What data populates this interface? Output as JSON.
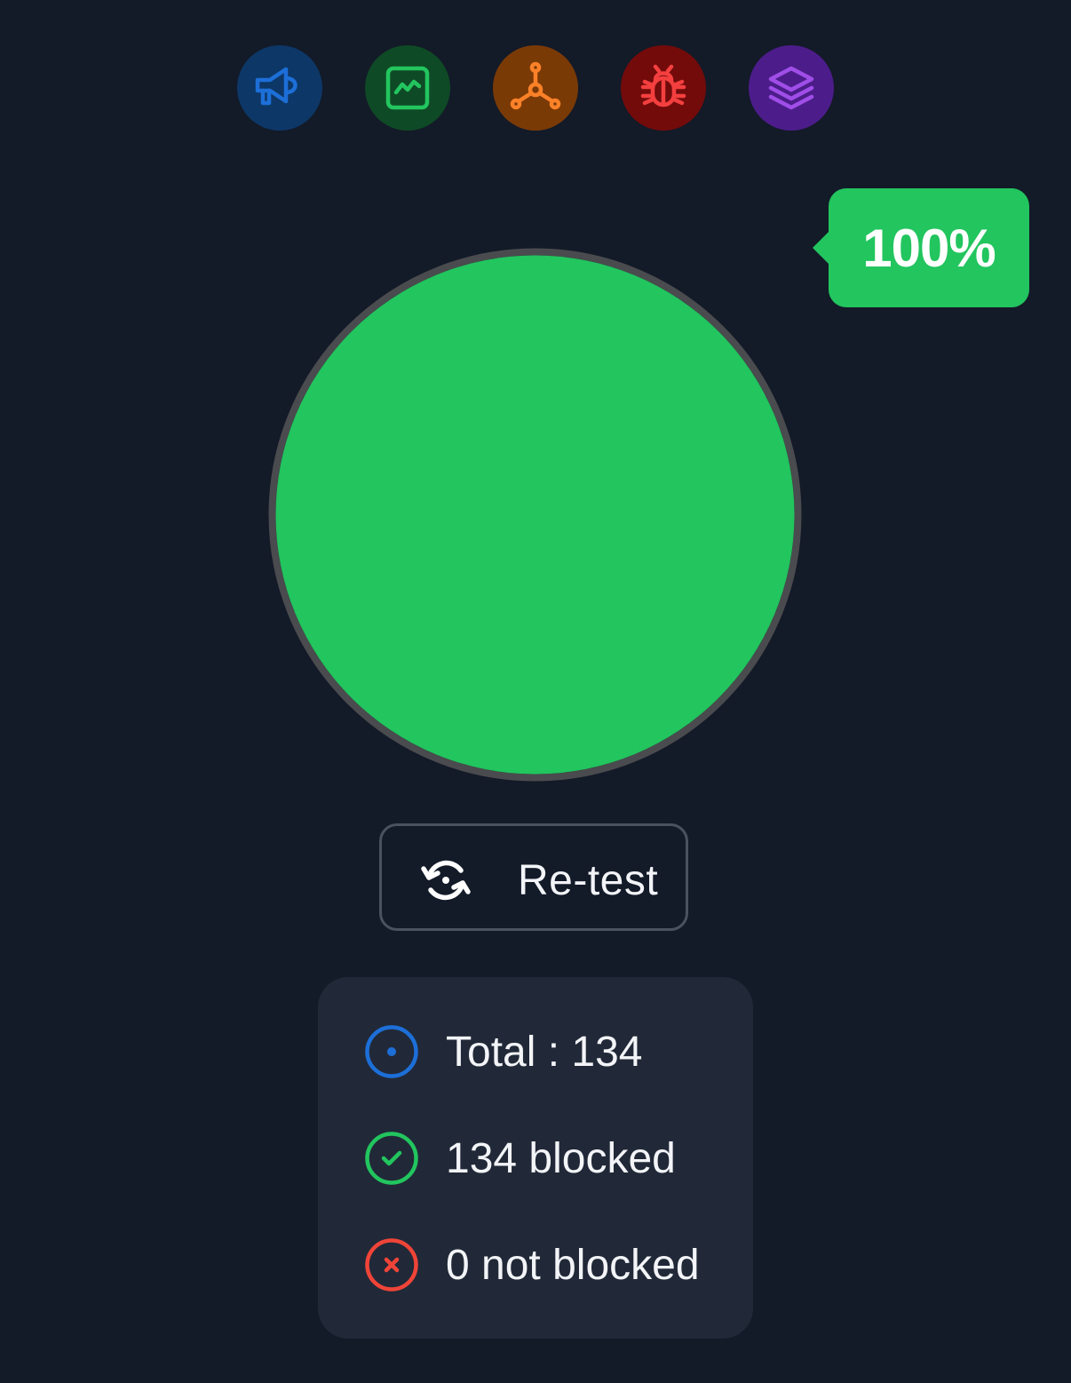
{
  "categories": [
    {
      "name": "ads",
      "icon": "megaphone-icon",
      "color": "#1d6fd8",
      "bg": "#0d3766"
    },
    {
      "name": "analytics",
      "icon": "chart-icon",
      "color": "#22c55e",
      "bg": "#0f4a26"
    },
    {
      "name": "trackers",
      "icon": "network-icon",
      "color": "#fb8128",
      "bg": "#7a3a06"
    },
    {
      "name": "malware",
      "icon": "bug-icon",
      "color": "#f43f3f",
      "bg": "#730b0b"
    },
    {
      "name": "other",
      "icon": "layers-icon",
      "color": "#a04ee8",
      "bg": "#4c1d8a"
    }
  ],
  "gauge": {
    "percent_label": "100%",
    "fill_fraction": 1.0,
    "fill_color": "#22c55e",
    "ring_color": "#4a4b4e"
  },
  "retest": {
    "label": "Re-test",
    "icon": "refresh-icon"
  },
  "stats": {
    "total": {
      "label": "Total : 134",
      "icon": "target-icon",
      "color": "#1d6fd8"
    },
    "blocked": {
      "label": "134 blocked",
      "icon": "check-circle-icon",
      "color": "#22c55e"
    },
    "not_blocked": {
      "label": "0 not blocked",
      "icon": "x-circle-icon",
      "color": "#f04438"
    }
  }
}
